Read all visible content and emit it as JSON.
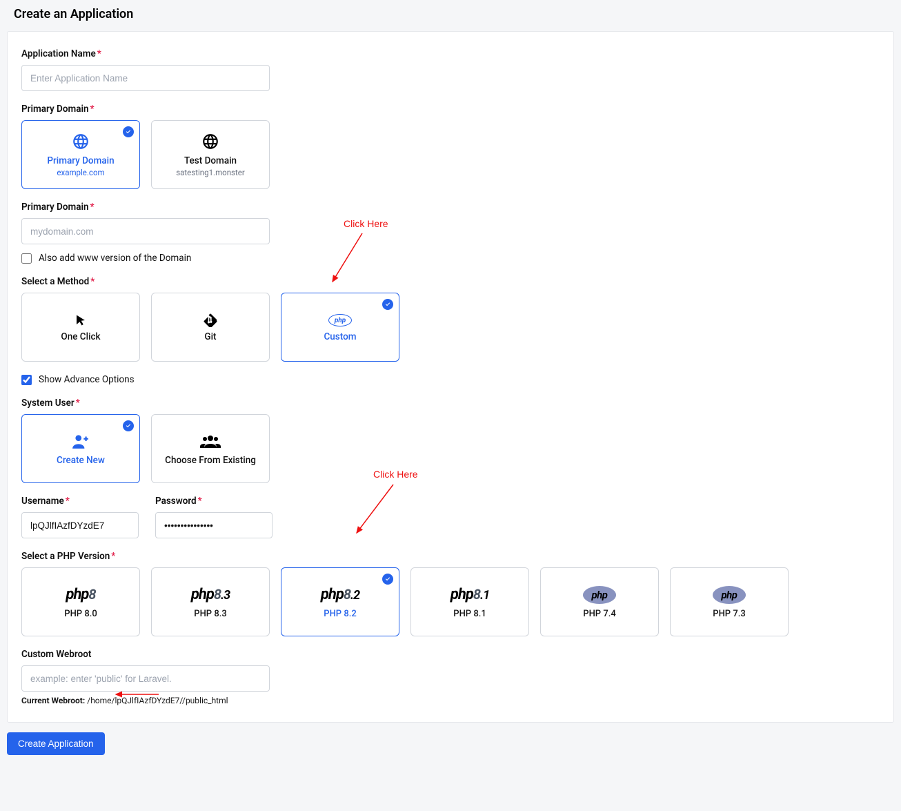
{
  "page": {
    "title": "Create an Application"
  },
  "app_name": {
    "label": "Application Name",
    "placeholder": "Enter Application Name",
    "value": ""
  },
  "primary_domain_select": {
    "label": "Primary Domain",
    "options": [
      {
        "title": "Primary Domain",
        "sub": "example.com",
        "selected": true
      },
      {
        "title": "Test Domain",
        "sub": "satesting1.monster",
        "selected": false
      }
    ]
  },
  "primary_domain_input": {
    "label": "Primary Domain",
    "placeholder": "mydomain.com",
    "value": ""
  },
  "www_checkbox": {
    "label": "Also add www version of the Domain",
    "checked": false
  },
  "method": {
    "label": "Select a Method",
    "options": [
      {
        "title": "One Click",
        "selected": false
      },
      {
        "title": "Git",
        "selected": false
      },
      {
        "title": "Custom",
        "selected": true
      }
    ]
  },
  "advanced_checkbox": {
    "label": "Show Advance Options",
    "checked": true
  },
  "system_user": {
    "label": "System User",
    "options": [
      {
        "title": "Create New",
        "selected": true
      },
      {
        "title": "Choose From Existing",
        "selected": false
      }
    ]
  },
  "username": {
    "label": "Username",
    "value": "lpQJlfIAzfDYzdE7"
  },
  "password": {
    "label": "Password",
    "value": "•••••••••••••••"
  },
  "php_version": {
    "label": "Select a PHP Version",
    "options": [
      {
        "title": "PHP 8.0",
        "ver": "8",
        "selected": false
      },
      {
        "title": "PHP 8.3",
        "ver": "8.3",
        "selected": false
      },
      {
        "title": "PHP 8.2",
        "ver": "8.2",
        "selected": true
      },
      {
        "title": "PHP 8.1",
        "ver": "8.1",
        "selected": false
      },
      {
        "title": "PHP 7.4",
        "ver": "",
        "selected": false
      },
      {
        "title": "PHP 7.3",
        "ver": "",
        "selected": false
      }
    ]
  },
  "webroot": {
    "label": "Custom Webroot",
    "placeholder": "example: enter 'public' for Laravel.",
    "value": "",
    "note_label": "Current Webroot:",
    "note_value": "/home/lpQJlfIAzfDYzdE7//public_html"
  },
  "submit": {
    "label": "Create Application"
  },
  "annotations": {
    "click_here": "Click Here"
  }
}
